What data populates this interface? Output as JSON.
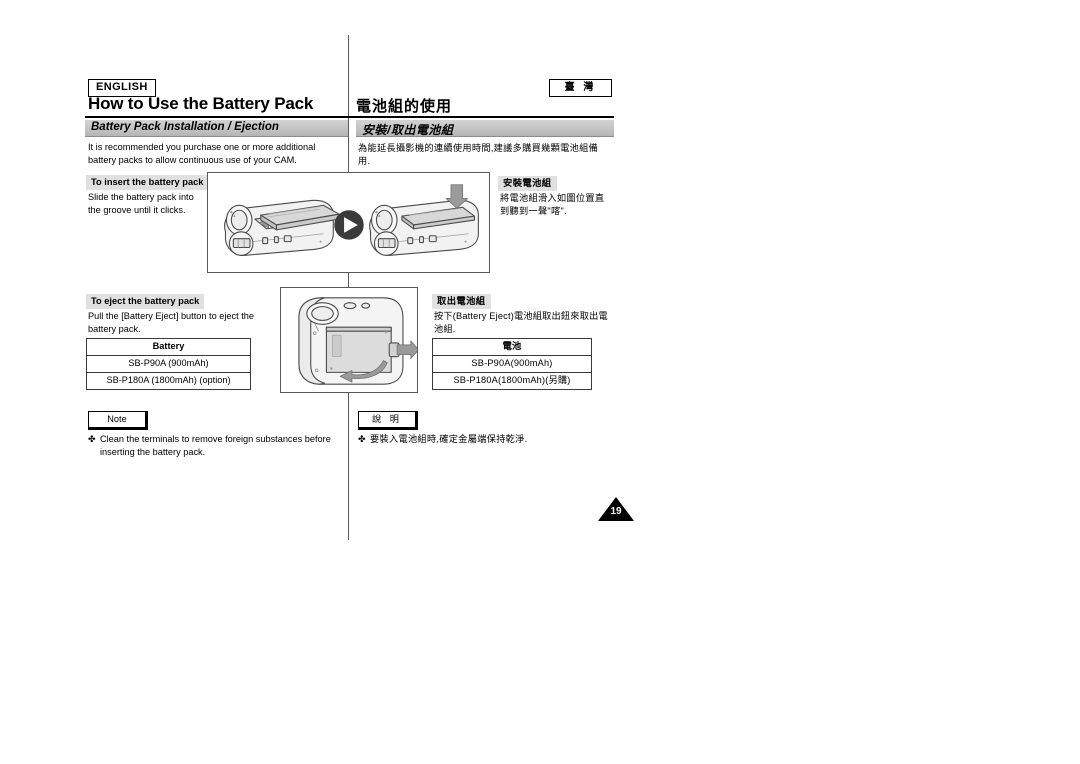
{
  "header": {
    "language_tag": "ENGLISH",
    "region_tag": "臺 灣",
    "title_en": "How to Use the Battery Pack",
    "title_zh": "電池組的使用"
  },
  "section": {
    "bar_en": "Battery Pack Installation / Ejection",
    "bar_zh": "安裝/取出電池組",
    "intro_en": "It is recommended you purchase one or more additional battery packs to allow continuous use of your CAM.",
    "intro_zh": "為能延長攝影機的連續使用時間,建議多購買幾顆電池組備用."
  },
  "insert": {
    "chip_en": "To insert the battery pack",
    "chip_zh": "安裝電池組",
    "text_en": "Slide the battery pack into the groove until it clicks.",
    "text_zh": "將電池組滑入如圖位置直到聽到一聲\"喀\"."
  },
  "eject": {
    "chip_en": "To eject the battery pack",
    "chip_zh": "取出電池組",
    "text_en": "Pull the [Battery Eject] button to eject the battery pack.",
    "text_zh": "按下(Battery Eject)電池組取出鈕來取出電池組."
  },
  "table_en": {
    "header": "Battery",
    "rows": [
      "SB-P90A (900mAh)",
      "SB-P180A (1800mAh) (option)"
    ]
  },
  "table_zh": {
    "header": "電池",
    "rows": [
      "SB-P90A(900mAh)",
      "SB-P180A(1800mAh)(另購)"
    ]
  },
  "note": {
    "chip_en": "Note",
    "chip_zh": "說 明",
    "bullet": "✤",
    "text_en": "Clean the terminals to remove foreign substances before inserting the battery pack.",
    "text_zh": "要裝入電池組時,確定金屬端保持乾淨."
  },
  "footer": {
    "page_number": "19"
  },
  "colors": {
    "section_bar": "#c4c4c4",
    "chip_bg": "#e0e0e0",
    "rule": "#000000",
    "illustration_fill": "#d8d8d8"
  }
}
